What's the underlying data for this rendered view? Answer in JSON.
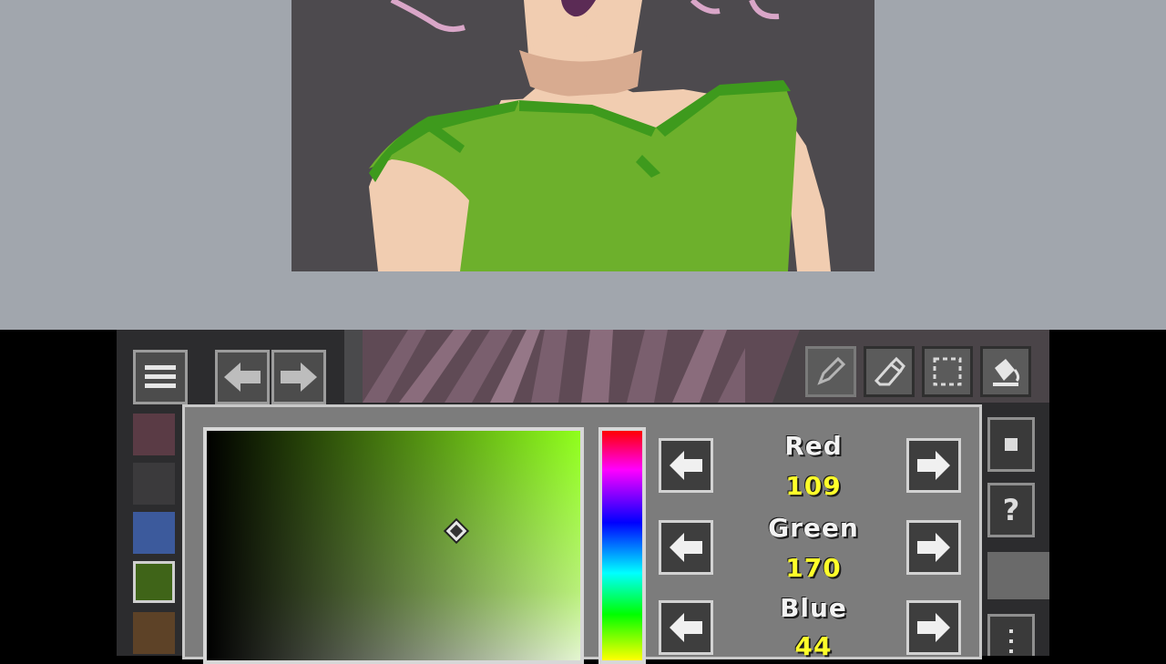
{
  "top_screen": {
    "background": "#a1a6ad",
    "artwork": {
      "subject": "pixel art woman in green top",
      "colors": {
        "background": "#4d4a4e",
        "skin": "#f1cdb1",
        "skin_shadow": "#d8ab90",
        "dress": "#6db02c",
        "dress_dark": "#3e9a1d",
        "hair_line": "#d9a6c8"
      }
    }
  },
  "toolbar": {
    "menu_icon": "menu-icon",
    "undo_icon": "arrow-left-icon",
    "redo_icon": "arrow-right-icon",
    "tools": [
      {
        "name": "pencil-icon"
      },
      {
        "name": "eraser-icon"
      },
      {
        "name": "selection-icon"
      },
      {
        "name": "fill-bucket-icon"
      }
    ],
    "side_buttons": [
      {
        "name": "stop-icon"
      },
      {
        "name": "help-icon",
        "label": "?"
      },
      {
        "name": "more-icon"
      }
    ]
  },
  "palette": {
    "swatches": [
      "#5a3b45",
      "#3b3a3c",
      "#3c5a9c",
      "#3f6418",
      "#5d4227"
    ],
    "selected_index": 3
  },
  "color_picker": {
    "channels": [
      {
        "label": "Red",
        "value": "109"
      },
      {
        "label": "Green",
        "value": "170"
      },
      {
        "label": "Blue",
        "value": "44"
      }
    ],
    "current_color": "#6daa2c"
  }
}
